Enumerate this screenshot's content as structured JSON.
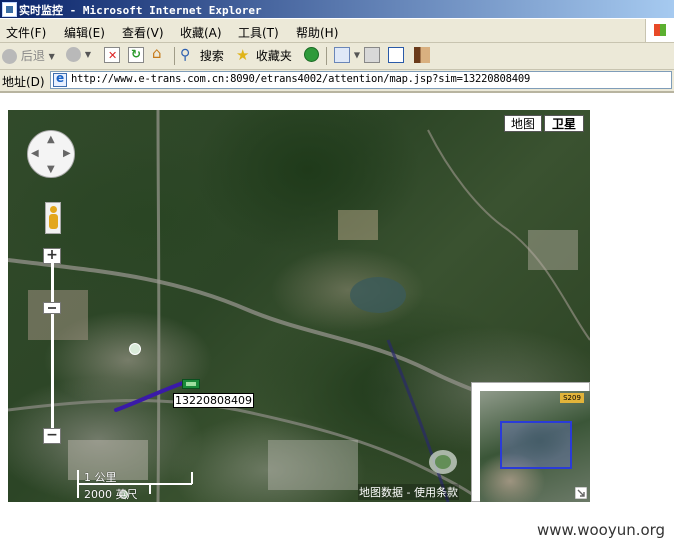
{
  "window": {
    "title": "实时监控 - Microsoft Internet Explorer"
  },
  "menu": [
    "文件(F)",
    "编辑(E)",
    "查看(V)",
    "收藏(A)",
    "工具(T)",
    "帮助(H)"
  ],
  "toolbar": {
    "back": "后退",
    "search": "搜索",
    "favorites": "收藏夹"
  },
  "address": {
    "label": "地址(D)",
    "url": "http://www.e-trans.com.cn:8090/etrans4002/attention/map.jsp?sim=13220808409"
  },
  "map": {
    "type_map": "地图",
    "type_satellite": "卫星",
    "selected_type": "卫星",
    "vehicle_label": "13220808409",
    "scale_metric": "1 公里",
    "scale_imperial": "2000 英尺",
    "copyright": "地图数据 - 使用条款",
    "overview_badge": "S209",
    "route_color": "#3a1aa8",
    "vehicle_marker_color": "#1a8a3a"
  },
  "watermark": "www.wooyun.org"
}
